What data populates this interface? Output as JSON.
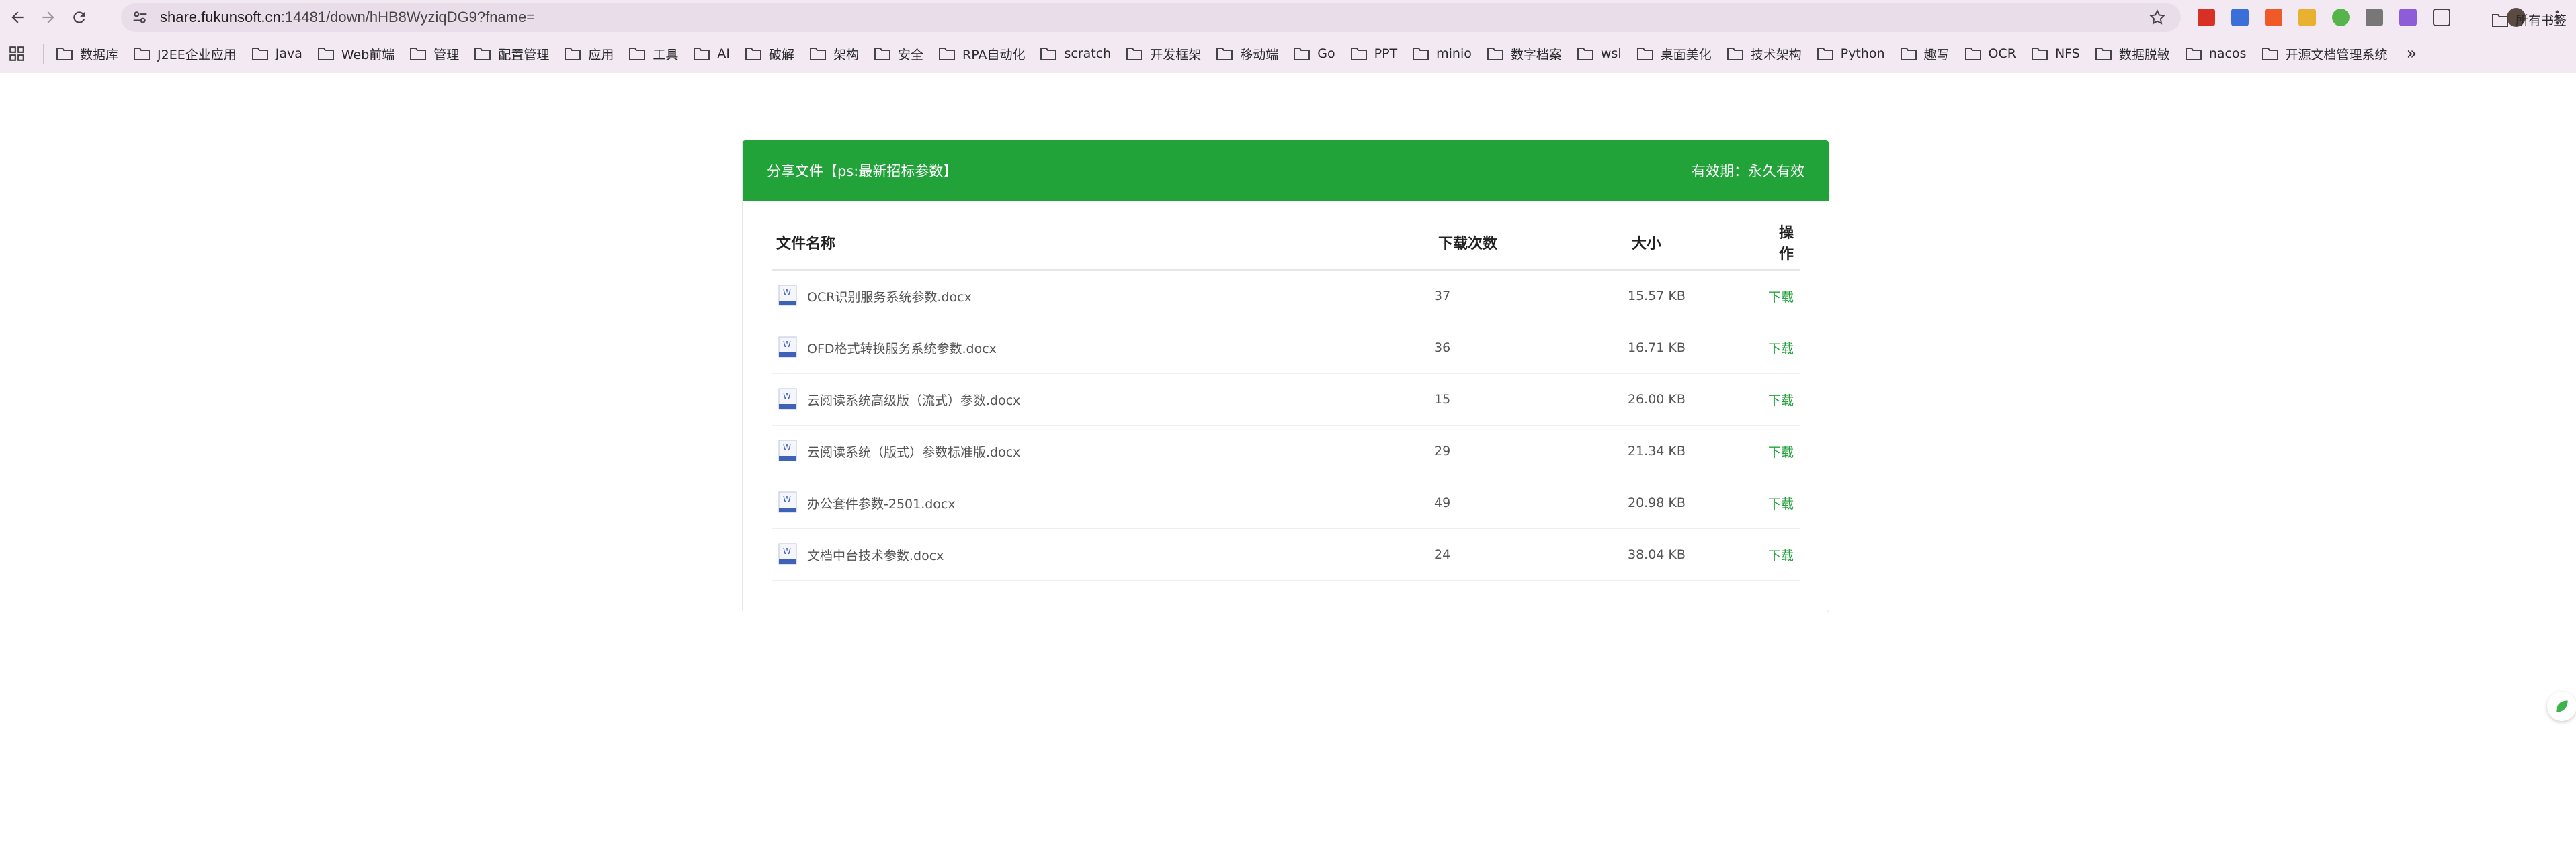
{
  "browser": {
    "url_host": "share.fukunsoft.cn",
    "url_path": ":14481/down/hHB8WyziqDG9?fname=",
    "bookmarks": [
      "数据库",
      "J2EE企业应用",
      "Java",
      "Web前端",
      "管理",
      "配置管理",
      "应用",
      "工具",
      "AI",
      "破解",
      "架构",
      "安全",
      "RPA自动化",
      "scratch",
      "开发框架",
      "移动端",
      "Go",
      "PPT",
      "minio",
      "数字档案",
      "wsl",
      "桌面美化",
      "技术架构",
      "Python",
      "趣写",
      "OCR",
      "NFS",
      "数据脱敏",
      "nacos",
      "开源文档管理系统"
    ],
    "bookmarks_more": "»",
    "all_bookmarks": "所有书签"
  },
  "share": {
    "title": "分享文件【ps:最新招标参数】",
    "validity": "有效期：永久有效",
    "columns": {
      "name": "文件名称",
      "count": "下载次数",
      "size": "大小",
      "op": "操作"
    },
    "files": [
      {
        "name": "OCR识别服务系统参数.docx",
        "count": "37",
        "size": "15.57 KB",
        "op": "下载"
      },
      {
        "name": "OFD格式转换服务系统参数.docx",
        "count": "36",
        "size": "16.71 KB",
        "op": "下载"
      },
      {
        "name": "云阅读系统高级版（流式）参数.docx",
        "count": "15",
        "size": "26.00 KB",
        "op": "下载"
      },
      {
        "name": "云阅读系统（版式）参数标准版.docx",
        "count": "29",
        "size": "21.34 KB",
        "op": "下载"
      },
      {
        "name": "办公套件参数-2501.docx",
        "count": "49",
        "size": "20.98 KB",
        "op": "下载"
      },
      {
        "name": "文档中台技术参数.docx",
        "count": "24",
        "size": "38.04 KB",
        "op": "下载"
      }
    ]
  },
  "colors": {
    "accent": "#21a33a",
    "chrome": "#f3e9f3"
  },
  "icons": {
    "file": "word-doc-icon",
    "bookmark": "folder-icon"
  }
}
